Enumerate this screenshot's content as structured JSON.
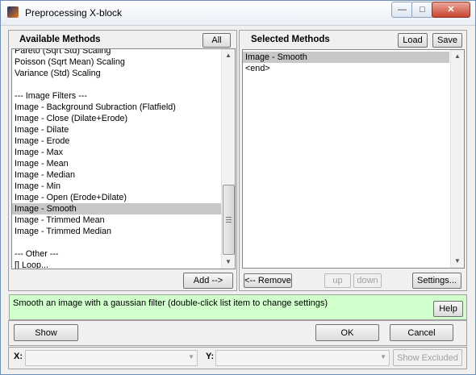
{
  "window": {
    "title": "Preprocessing X-block",
    "icon": "matlab-icon"
  },
  "available": {
    "header": "Available Methods",
    "all_label": "All",
    "add_label": "Add -->",
    "items": [
      "Pareto (Sqrt Std) Scaling",
      "Poisson (Sqrt Mean) Scaling",
      "Variance (Std) Scaling",
      "",
      "--- Image Filters ---",
      "Image - Background Subraction (Flatfield)",
      "Image - Close (Dilate+Erode)",
      "Image - Dilate",
      "Image - Erode",
      "Image - Max",
      "Image - Mean",
      "Image - Median",
      "Image - Min",
      "Image - Open (Erode+Dilate)",
      "Image - Smooth",
      "Image - Trimmed Mean",
      "Image - Trimmed Median",
      "",
      "--- Other ---",
      "[] Loop..."
    ],
    "selected_item": "Image - Smooth"
  },
  "selected": {
    "header": "Selected Methods",
    "load_label": "Load",
    "save_label": "Save",
    "items": [
      "Image - Smooth",
      "<end>"
    ],
    "selected_item": "Image - Smooth",
    "remove_label": "<-- Remove",
    "up_label": "up",
    "down_label": "down",
    "settings_label": "Settings..."
  },
  "description": {
    "text": "Smooth an image with a gaussian filter (double-click list item to change settings)",
    "help_label": "Help",
    "bg_color": "#d0ffcc"
  },
  "actions": {
    "show_label": "Show",
    "ok_label": "OK",
    "cancel_label": "Cancel"
  },
  "axes": {
    "x_label": "X:",
    "x_value": "",
    "y_label": "Y:",
    "y_value": "",
    "show_excluded_label": "Show Excluded"
  }
}
